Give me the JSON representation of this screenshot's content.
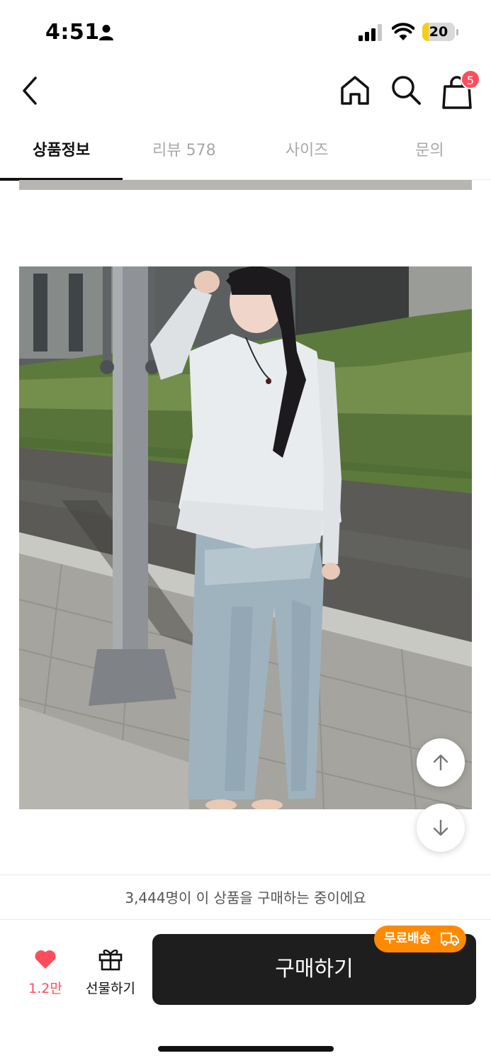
{
  "status_bar": {
    "time": "4:51",
    "battery_level": "20",
    "battery_fraction": 0.2
  },
  "nav": {
    "cart_count": "5"
  },
  "tabs": [
    {
      "label": "상품정보",
      "active": true
    },
    {
      "label": "리뷰 578",
      "active": false
    },
    {
      "label": "사이즈",
      "active": false
    },
    {
      "label": "문의",
      "active": false
    }
  ],
  "notice": {
    "text": "3,444명이 이 상품을 구매하는 중이에요"
  },
  "actions": {
    "like_count": "1.2만",
    "gift_label": "선물하기",
    "buy_label": "구매하기",
    "free_shipping_badge": "무료배송"
  },
  "colors": {
    "accent": "#ff4d5e",
    "badge_orange": "#ff8a00",
    "buy_button": "#1e1e1e"
  },
  "icons": [
    "person-icon",
    "signal-icon",
    "wifi-icon",
    "battery-icon",
    "back-arrow-icon",
    "home-icon",
    "search-icon",
    "shopping-bag-icon",
    "heart-icon",
    "gift-icon",
    "truck-icon",
    "arrow-up-icon",
    "arrow-down-icon"
  ]
}
